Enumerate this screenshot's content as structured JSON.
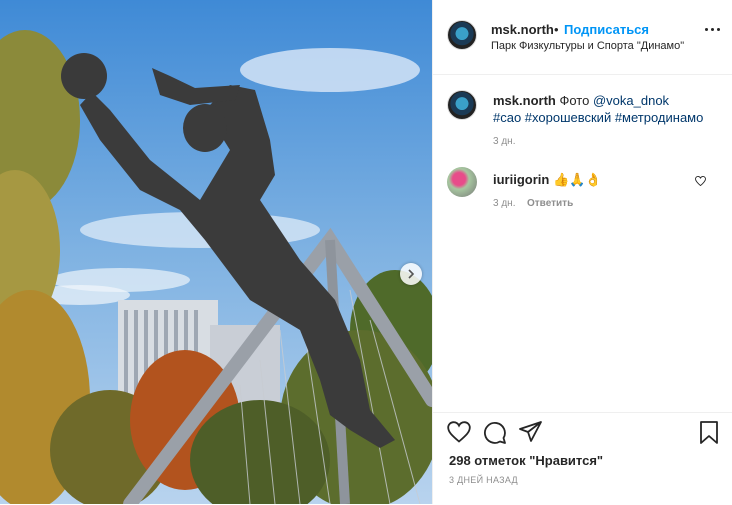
{
  "header": {
    "username": "msk.north",
    "separator": "•",
    "follow_label": "Подписаться",
    "location": "Парк Физкультуры и Спорта \"Динамо\""
  },
  "caption": {
    "username": "msk.north",
    "word": "Фото",
    "mention": "@voka_dnok",
    "hashtags": "#сао #хорошевский #метродинамо",
    "time": "3 дн."
  },
  "comments": [
    {
      "username": "iuriigorin",
      "text": "👍🙏👌",
      "time": "3 дн.",
      "reply_label": "Ответить"
    }
  ],
  "footer": {
    "likes": "298 отметок \"Нравится\"",
    "posted_ago": "3 ДНЕЙ НАЗАД"
  },
  "icons": {
    "like": "heart-icon",
    "comment": "comment-icon",
    "share": "share-icon",
    "save": "bookmark-icon",
    "next": "chevron-right-icon",
    "more": "more-icon"
  },
  "colors": {
    "follow": "#0095f6",
    "link": "#00376b",
    "muted": "#8e8e8e",
    "sky": "#6fa7dc",
    "statue": "#3b3b3b"
  }
}
